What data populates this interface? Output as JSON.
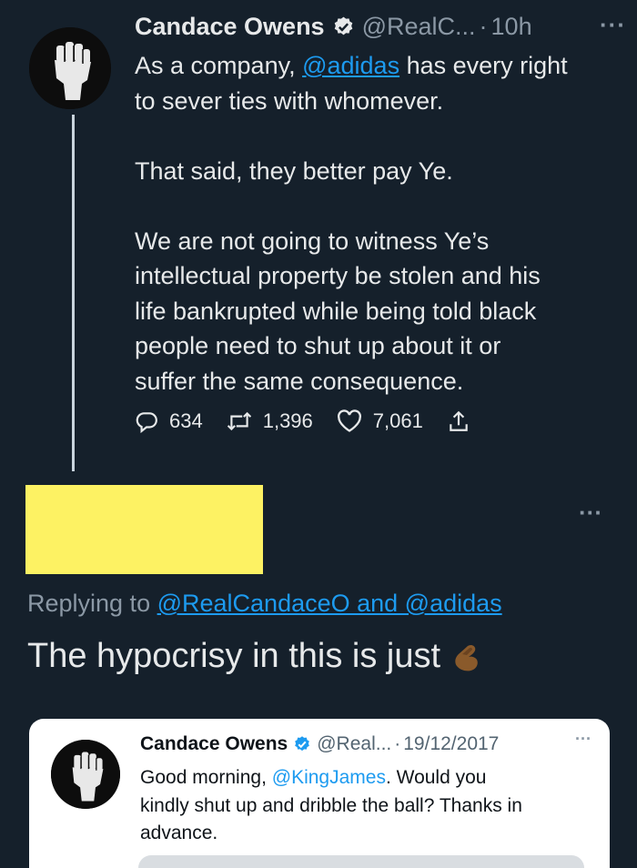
{
  "main_tweet": {
    "author_name": "Candace Owens",
    "handle": "@RealC...",
    "separator": "·",
    "time": "10h",
    "more_label": "···",
    "body_line1_prefix": "As a company, ",
    "body_mention": "@adidas",
    "body_line1_suffix": " has every right",
    "body_line2": "to sever ties with whomever.",
    "body_para2": "That said, they better pay Ye.",
    "body_para3_lines": [
      "We are not going to witness Ye’s",
      "intellectual property be stolen and his",
      "life bankrupted while being told black",
      "people need to shut up about it or",
      "suffer the same consequence."
    ],
    "reply_count": "634",
    "retweet_count": "1,396",
    "like_count": "7,061"
  },
  "reply_tweet": {
    "more_label": "···",
    "replying_prefix": "Replying to ",
    "replying_to": "@RealCandaceO and @adidas",
    "text": "The hypocrisy in this is just",
    "redaction_color": "#fdf263"
  },
  "quoted_tweet": {
    "author_name": "Candace Owens",
    "handle": "@Real...",
    "separator": "·",
    "date": "19/12/2017",
    "more_label": "···",
    "text_prefix": "Good morning, ",
    "mention": "@KingJames",
    "text_suffix": ". Would you",
    "line2": "kindly shut up and dribble the ball? Thanks in",
    "line3": "advance."
  },
  "colors": {
    "background": "#15202b",
    "link": "#1d9bf0",
    "muted": "#8b98a5",
    "verified": "#1d9bf0"
  },
  "icons": [
    "fist-avatar-icon",
    "verified-badge-icon",
    "reply-icon",
    "retweet-icon",
    "like-icon",
    "share-icon",
    "pinching-hand-emoji-icon"
  ]
}
